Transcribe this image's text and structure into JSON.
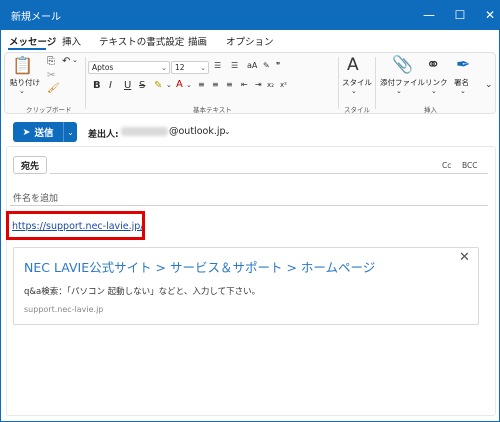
{
  "window": {
    "title": "新規メール",
    "minimize": "—",
    "maximize": "☐",
    "close": "✕"
  },
  "menu": {
    "tabs": [
      "メッセージ",
      "挿入",
      "テキストの書式設定",
      "描画",
      "オプション"
    ]
  },
  "ribbon": {
    "paste_label": "貼り付け",
    "clipboard_group": "クリップボード",
    "font_name": "Aptos",
    "font_size": "12",
    "basic_text_group": "基本テキスト",
    "style_label": "スタイル",
    "style_group": "スタイル",
    "attach_label": "添付ファイル",
    "link_label": "リンク",
    "signature_label": "署名",
    "insert_group": "挿入",
    "bold": "B",
    "italic": "I",
    "underline": "U",
    "strike": "S",
    "subscript": "x₂",
    "superscript": "x²"
  },
  "compose": {
    "send_label": "送信",
    "from_label": "差出人:",
    "from_address": "@outlook.jp",
    "to_label": "宛先",
    "cc_label": "Cc",
    "bcc_label": "BCC",
    "subject_placeholder": "件名を追加"
  },
  "body": {
    "link_text": "https://support.nec-lavie.jp/",
    "preview": {
      "title": "NEC LAVIE公式サイト > サービス＆サポート > ホームページ",
      "description": "q&a検索：「パソコン 起動しない」などと、入力して下さい。",
      "domain": "support.nec-lavie.jp",
      "close": "✕"
    }
  },
  "colors": {
    "accent": "#0f6cbd",
    "highlight_box": "#e00000",
    "link": "#1a4aa3",
    "preview_title": "#2b78c4"
  }
}
